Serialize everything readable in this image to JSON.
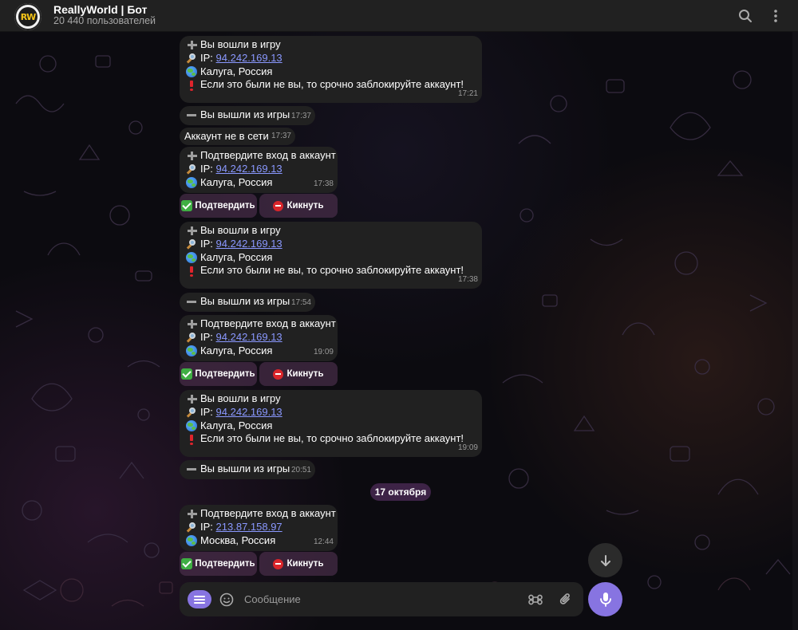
{
  "chat": {
    "title": "ReallyWorld | Бот",
    "subtitle": "20 440 пользователей",
    "avatar_text": "RW"
  },
  "messages": [
    {
      "lines": [
        "Вы вошли в игру",
        "IP: ",
        "94.242.169.13",
        "Калуга, Россия",
        "Если это были не вы, то срочно заблокируйте аккаунт!"
      ],
      "time": "17:21"
    },
    {
      "text": "Вы вышли из игры",
      "time": "17:37"
    },
    {
      "text": "Аккаунт не в сети",
      "time": "17:37"
    },
    {
      "lines": [
        "Подтвердите вход в аккаунт",
        "IP: ",
        "94.242.169.13",
        "Калуга, Россия"
      ],
      "time": "17:38"
    },
    {
      "lines": [
        "Вы вошли в игру",
        "IP: ",
        "94.242.169.13",
        "Калуга, Россия",
        "Если это были не вы, то срочно заблокируйте аккаунт!"
      ],
      "time": "17:38"
    },
    {
      "text": "Вы вышли из игры",
      "time": "17:54"
    },
    {
      "lines": [
        "Подтвердите вход в аккаунт",
        "IP: ",
        "94.242.169.13",
        "Калуга, Россия"
      ],
      "time": "19:09"
    },
    {
      "lines": [
        "Вы вошли в игру",
        "IP: ",
        "94.242.169.13",
        "Калуга, Россия",
        "Если это были не вы, то срочно заблокируйте аккаунт!"
      ],
      "time": "19:09"
    },
    {
      "text": "Вы вышли из игры",
      "time": "20:51"
    },
    {
      "lines": [
        "Подтвердите вход в аккаунт",
        "IP: ",
        "213.87.158.97",
        "Москва, Россия"
      ],
      "time": "12:44"
    }
  ],
  "buttons": {
    "confirm": "Подтвердить",
    "kick": "Кикнуть"
  },
  "date_separator": "17 октября",
  "composer": {
    "placeholder": "Сообщение"
  },
  "colors": {
    "accent": "#8774e1",
    "link": "#8a98ff",
    "bubble": "#212121"
  },
  "icons": {
    "header": [
      "search-icon",
      "more-vertical-icon"
    ],
    "composer": [
      "menu-icon",
      "emoji-icon",
      "command-icon",
      "paperclip-icon",
      "microphone-icon"
    ],
    "scroll": "arrow-down-icon"
  }
}
